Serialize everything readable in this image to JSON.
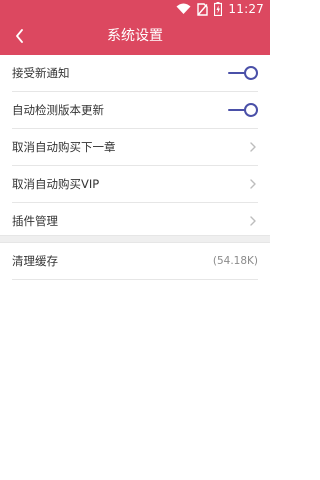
{
  "status": {
    "time": "11:27"
  },
  "header": {
    "title": "系统设置"
  },
  "settings": [
    {
      "label": "接受新通知",
      "type": "toggle",
      "value": true
    },
    {
      "label": "自动检测版本更新",
      "type": "toggle",
      "value": true
    },
    {
      "label": "取消自动购买下一章",
      "type": "link"
    },
    {
      "label": "取消自动购买VIP",
      "type": "link"
    },
    {
      "label": "插件管理",
      "type": "link"
    }
  ],
  "cache": {
    "label": "清理缓存",
    "size": "(54.18K)"
  },
  "colors": {
    "header": "#dc4860",
    "toggle": "#4a50a8",
    "divider": "#e6e6e6"
  }
}
